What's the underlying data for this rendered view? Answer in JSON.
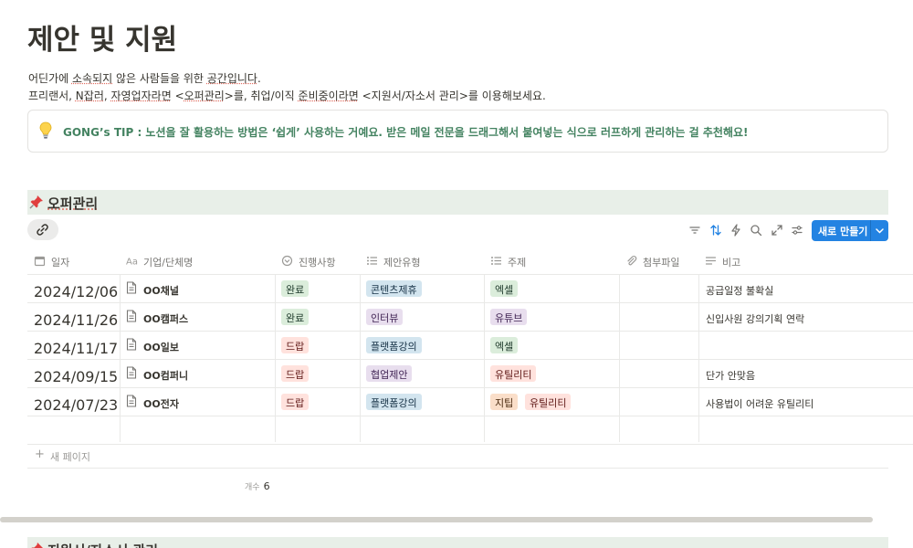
{
  "page": {
    "title": "제안 및 지원",
    "desc_line1": {
      "a": "어딘가에 ",
      "b": "소속되지",
      "c": " 않은 사람들을 위한 ",
      "d": "공간입니다",
      "e": "."
    },
    "desc_line2": {
      "a": "프리랜서, ",
      "b": "N잡러",
      "c": ", ",
      "d": "자영업자라면",
      "e": " <",
      "f": "오퍼관리",
      "g": ">를, 취업/이직 ",
      "h": "준비중이라면",
      "i": " <지원서/자소서 관리>를 이용해보세요."
    },
    "callout": {
      "icon": "lightbulb-icon",
      "text": "GONG’s TIP : 노션을 잘 활용하는 방법은 ‘쉽게’ 사용하는 거예요. 받은 메일 전문을 드래그해서 붙여넣는 식으로 러프하게 관리하는 걸 추천해요!"
    }
  },
  "section1": {
    "title": "오퍼관리",
    "icon": "pushpin-icon"
  },
  "section2": {
    "title": "지원서/자소서 관리",
    "icon": "pushpin-icon"
  },
  "toolbar": {
    "new_button": "새로 만들기"
  },
  "table": {
    "headers": {
      "date": "일자",
      "company": "기업/단체명",
      "status": "진행사항",
      "type": "제안유형",
      "topic": "주제",
      "attachment": "첨부파일",
      "note": "비고"
    },
    "rows": [
      {
        "date": "2024/12/06",
        "company": "OO채널",
        "status": "완료",
        "type": "콘텐츠제휴",
        "topic": [
          "엑셀"
        ],
        "note": "공급일정 불확실"
      },
      {
        "date": "2024/11/26",
        "company": "OO캠퍼스",
        "status": "완료",
        "type": "인터뷰",
        "topic": [
          "유튜브"
        ],
        "note": "신입사원 강의기획 연락"
      },
      {
        "date": "2024/11/17",
        "company": "OO일보",
        "status": "드랍",
        "type": "플랫폼강의",
        "topic": [
          "엑셀"
        ],
        "note": ""
      },
      {
        "date": "2024/09/15",
        "company": "OO컴퍼니",
        "status": "드랍",
        "type": "협업제안",
        "topic": [
          "유틸리티"
        ],
        "note": "단가 안맞음"
      },
      {
        "date": "2024/07/23",
        "company": "OO전자",
        "status": "드랍",
        "type": "플랫폼강의",
        "topic": [
          "지팁",
          "유틸리티"
        ],
        "note": "사용법이 어려운 유틸리티"
      }
    ],
    "new_page": "새 페이지",
    "count_label": "개수",
    "count_value": "6"
  }
}
